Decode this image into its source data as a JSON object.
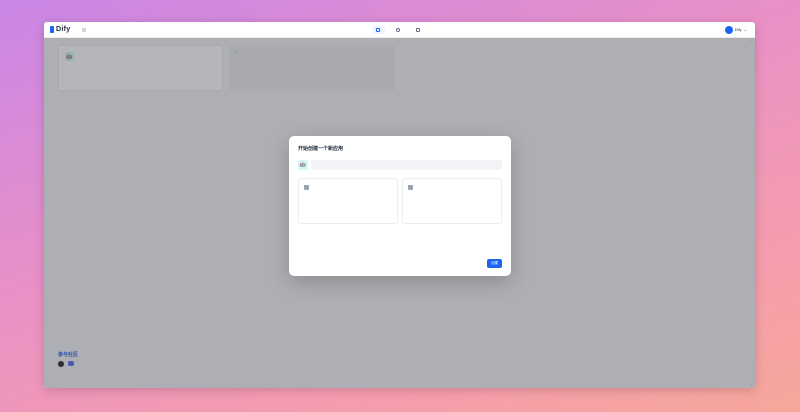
{
  "topbar": {
    "logo": "Dify",
    "workspace": "",
    "nav": [
      {
        "label": "",
        "icon": "grid-icon",
        "active": true
      },
      {
        "label": "",
        "icon": "compass-icon",
        "active": false
      },
      {
        "label": "",
        "icon": "book-icon",
        "active": false
      }
    ],
    "user": {
      "avatar": "",
      "name": "Dify"
    }
  },
  "apps": [
    {
      "icon": "🤖",
      "name": "",
      "description": "",
      "footer": ""
    }
  ],
  "new_app_card": {
    "label": ""
  },
  "community": {
    "title": "参与社区",
    "subtitle": "",
    "icons": [
      "github-icon",
      "discord-icon"
    ]
  },
  "modal": {
    "title": "开始创建一个新应用",
    "name_label": "",
    "icon": "🤖",
    "name_placeholder": "",
    "type_label": "",
    "types": [
      {
        "name": "",
        "icon": "chat-icon",
        "description": "",
        "preview": ""
      },
      {
        "name": "",
        "icon": "text-icon",
        "description": "",
        "preview": ""
      }
    ],
    "link": "",
    "cancel_label": "",
    "create_label": "创建"
  },
  "colors": {
    "accent": "#1c64f2",
    "overlay": "rgba(60,64,72,0.38)"
  }
}
